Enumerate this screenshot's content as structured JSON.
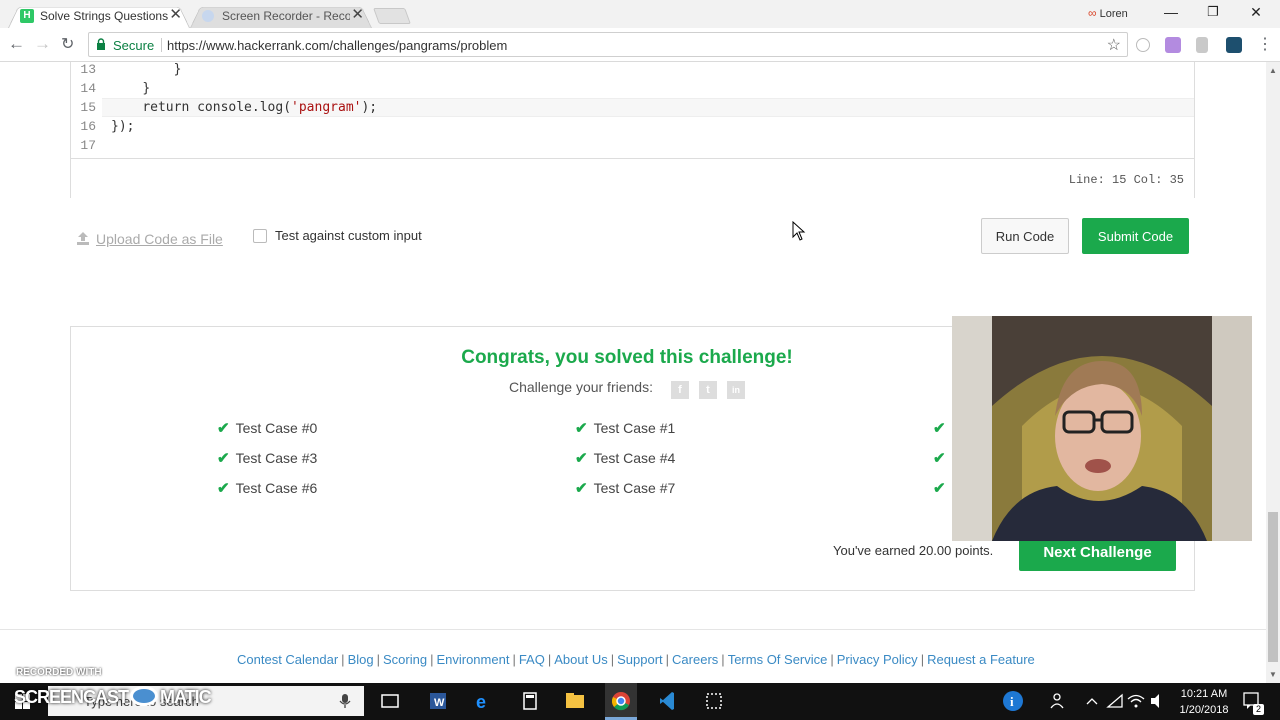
{
  "browser": {
    "tabs": [
      {
        "title": "Solve Strings Questions |",
        "active": true
      },
      {
        "title": "Screen Recorder - Recor",
        "active": false
      }
    ],
    "profile_name": "Loren",
    "secure_label": "Secure",
    "url": "https://www.hackerrank.com/challenges/pangrams/problem"
  },
  "editor": {
    "lines": [
      {
        "num": "13",
        "indent": "        ",
        "text": "}"
      },
      {
        "num": "14",
        "indent": "    ",
        "text": "}"
      },
      {
        "num": "15",
        "indent": "    ",
        "text": "return console.log('pangram');"
      },
      {
        "num": "16",
        "indent": "",
        "text": "});"
      },
      {
        "num": "17",
        "indent": "",
        "text": ""
      }
    ],
    "line_col": "Line: 15 Col: 35"
  },
  "actions": {
    "upload_label": "Upload Code as File",
    "custom_input_label": "Test against custom input",
    "run_label": "Run Code",
    "submit_label": "Submit Code"
  },
  "results": {
    "congrats": "Congrats, you solved this challenge!",
    "challenge_friends": "Challenge your friends:",
    "social": [
      "f",
      "t",
      "in"
    ],
    "test_cases": [
      [
        "Test Case #0",
        "Test Case #1"
      ],
      [
        "Test Case #3",
        "Test Case #4"
      ],
      [
        "Test Case #6",
        "Test Case #7"
      ]
    ],
    "earned": "You've earned 20.00 points.",
    "next_label": "Next Challenge"
  },
  "footer": {
    "links": [
      "Contest Calendar",
      "Blog",
      "Scoring",
      "Environment",
      "FAQ",
      "About Us",
      "Support",
      "Careers",
      "Terms Of Service",
      "Privacy Policy",
      "Request a Feature"
    ]
  },
  "overlay": {
    "recorded_with": "RECORDED WITH",
    "brand": "SCREENCAST",
    "brand_suffix": "MATIC"
  },
  "taskbar": {
    "search_placeholder": "Type here to search",
    "time": "10:21 AM",
    "date": "1/20/2018",
    "notifications": "2"
  },
  "colors": {
    "accent_green": "#1ba94c",
    "link_blue": "#3a8ac4"
  }
}
